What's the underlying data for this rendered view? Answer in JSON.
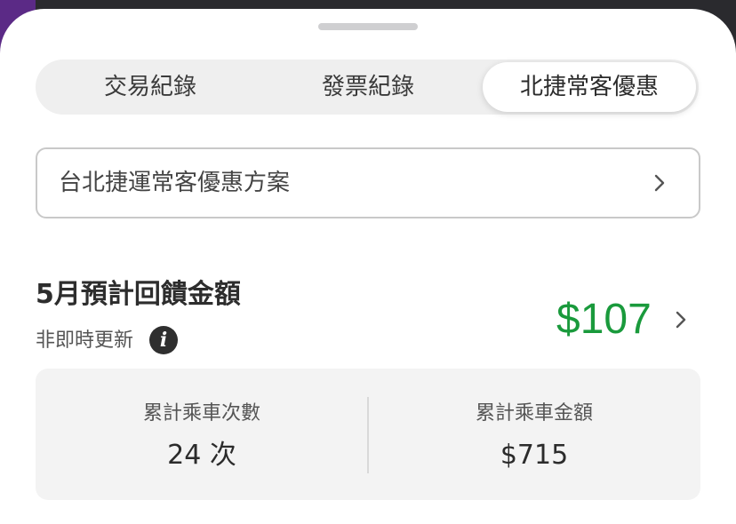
{
  "tabs": {
    "transactions_label": "交易紀錄",
    "invoices_label": "發票紀錄",
    "discount_label": "北捷常客優惠"
  },
  "plan": {
    "label": "台北捷運常客優惠方案"
  },
  "rebate": {
    "title": "5月預計回饋金額",
    "subtitle": "非即時更新",
    "info_icon": "i",
    "amount": "$107"
  },
  "stats": {
    "rides_label": "累計乘車次數",
    "rides_value": "24 次",
    "fare_label": "累計乘車金額",
    "fare_value": "$715"
  },
  "colors": {
    "accent_green": "#1a9a3c",
    "brand_purple": "#5b2a86"
  },
  "icons": [
    "chevron-right-icon",
    "info-icon",
    "grabber-handle"
  ]
}
